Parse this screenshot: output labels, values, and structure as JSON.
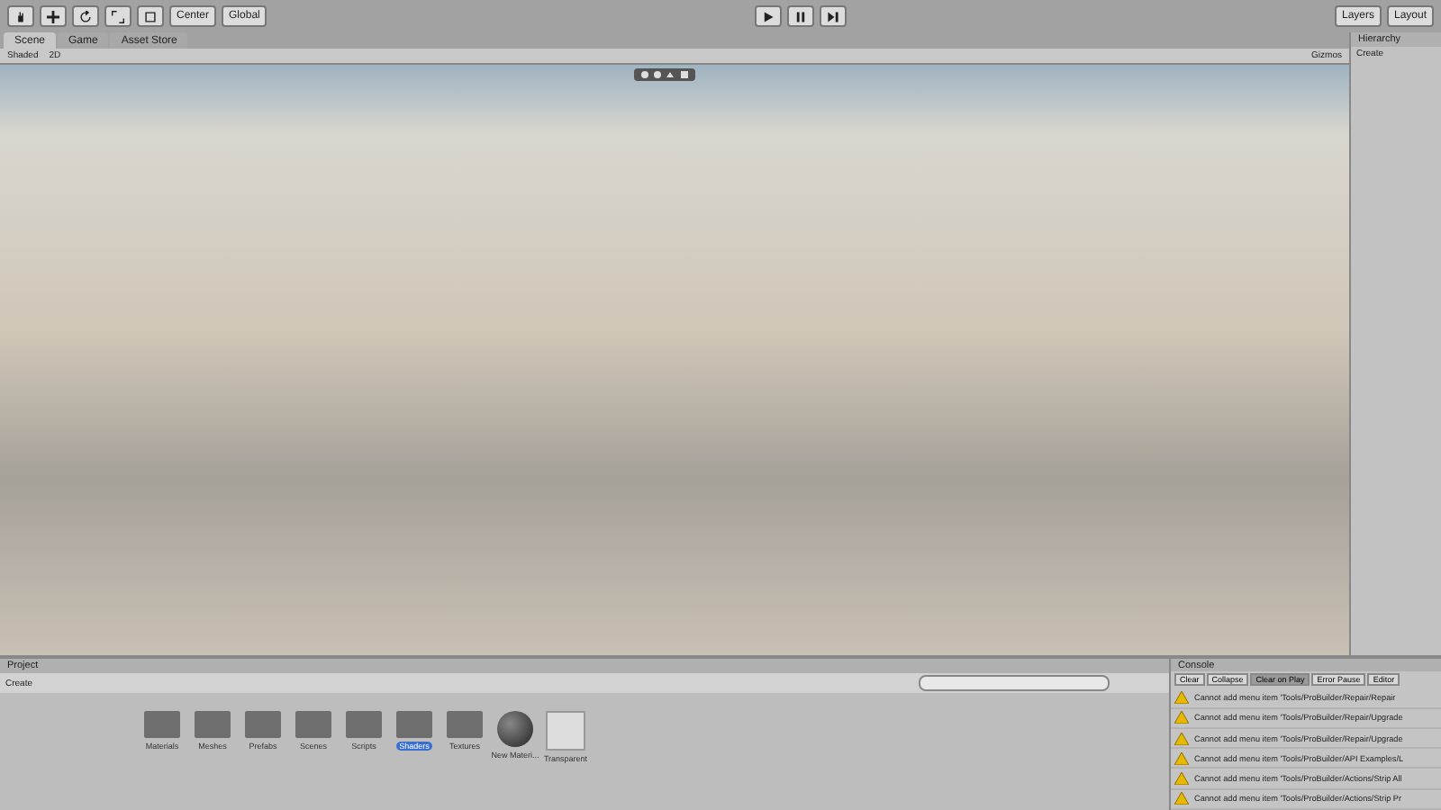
{
  "toolbar": {
    "pivot": "Center",
    "space": "Global",
    "layers": "Layers",
    "layout": "Layout"
  },
  "scene_tabs": [
    {
      "label": "Scene",
      "selected": true
    },
    {
      "label": "Game",
      "selected": false
    },
    {
      "label": "Asset Store",
      "selected": false
    }
  ],
  "scene_toolbar": {
    "shading": "Shaded",
    "mode": "2D",
    "gizmos": "Gizmos"
  },
  "hierarchy": {
    "title": "Hierarchy",
    "create": "Create"
  },
  "project": {
    "title": "Project",
    "create": "Create",
    "assets": [
      {
        "label": "Materials",
        "kind": "folder",
        "selected": false
      },
      {
        "label": "Meshes",
        "kind": "folder",
        "selected": false
      },
      {
        "label": "Prefabs",
        "kind": "folder",
        "selected": false
      },
      {
        "label": "Scenes",
        "kind": "folder",
        "selected": false
      },
      {
        "label": "Scripts",
        "kind": "folder",
        "selected": false
      },
      {
        "label": "Shaders",
        "kind": "folder",
        "selected": true
      },
      {
        "label": "Textures",
        "kind": "folder",
        "selected": false
      },
      {
        "label": "New Materi...",
        "kind": "sphere",
        "selected": false
      },
      {
        "label": "Transparent",
        "kind": "asset",
        "selected": false
      }
    ]
  },
  "console": {
    "title": "Console",
    "buttons": [
      {
        "label": "Clear",
        "selected": false
      },
      {
        "label": "Collapse",
        "selected": false
      },
      {
        "label": "Clear on Play",
        "selected": true
      },
      {
        "label": "Error Pause",
        "selected": false
      },
      {
        "label": "Editor",
        "selected": false
      }
    ],
    "messages": [
      "Cannot add menu item 'Tools/ProBuilder/Repair/Repair",
      "Cannot add menu item 'Tools/ProBuilder/Repair/Upgrade",
      "Cannot add menu item 'Tools/ProBuilder/Repair/Upgrade",
      "Cannot add menu item 'Tools/ProBuilder/API Examples/L",
      "Cannot add menu item 'Tools/ProBuilder/Actions/Strip All",
      "Cannot add menu item 'Tools/ProBuilder/Actions/Strip Pr"
    ]
  }
}
